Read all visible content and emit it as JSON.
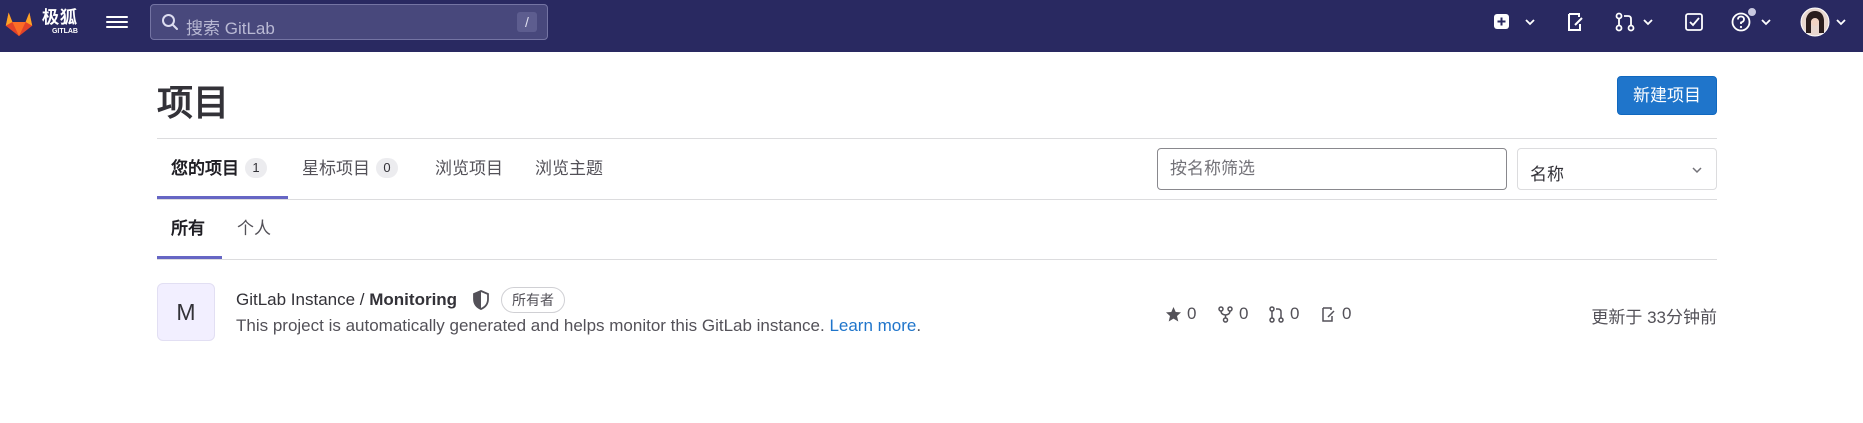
{
  "brand": {
    "name_cn": "极狐",
    "name_en": "GITLAB"
  },
  "search": {
    "placeholder": "搜索 GitLab",
    "shortcut": "/"
  },
  "page": {
    "title": "项目",
    "new_button": "新建项目"
  },
  "tabs": [
    {
      "label": "您的项目",
      "count": "1"
    },
    {
      "label": "星标项目",
      "count": "0"
    },
    {
      "label": "浏览项目"
    },
    {
      "label": "浏览主题"
    }
  ],
  "filter": {
    "placeholder": "按名称筛选",
    "sort_label": "名称"
  },
  "subtabs": [
    {
      "label": "所有"
    },
    {
      "label": "个人"
    }
  ],
  "project": {
    "avatar_letter": "M",
    "namespace": "GitLab Instance / ",
    "name": "Monitoring",
    "role": "所有者",
    "description": "This project is automatically generated and helps monitor this GitLab instance. ",
    "learn_more": "Learn more",
    "period": ".",
    "stars": "0",
    "forks": "0",
    "merge_requests": "0",
    "issues": "0",
    "updated": "更新于 33分钟前"
  },
  "colors": {
    "navbar": "#292961",
    "primary": "#1f75cb",
    "tab_underline": "#6666c4"
  }
}
